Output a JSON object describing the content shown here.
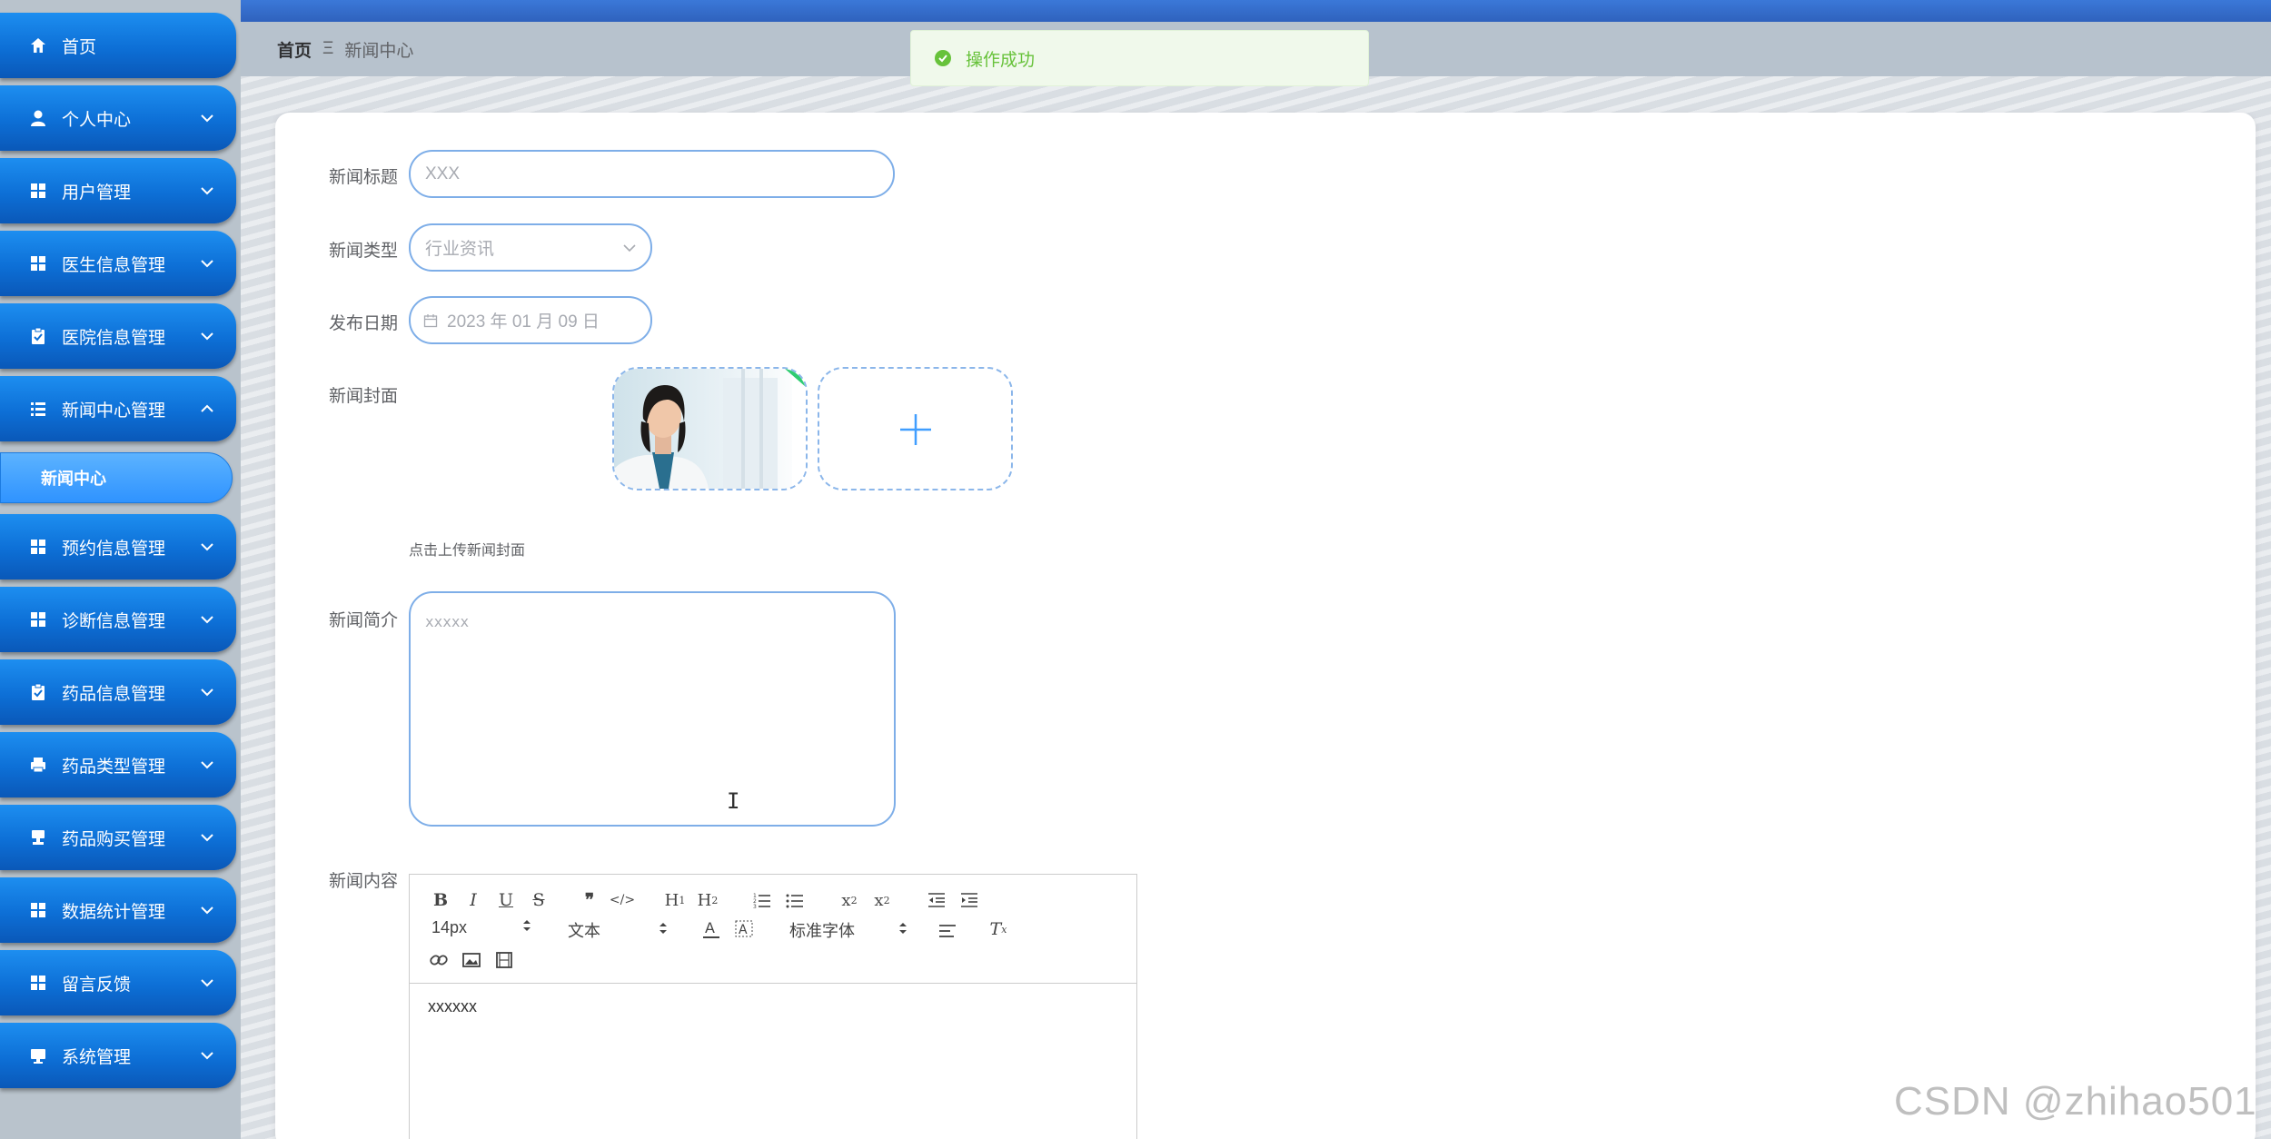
{
  "sidebar": {
    "items": [
      {
        "label": "首页",
        "icon": "home-icon",
        "arrow": ""
      },
      {
        "label": "个人中心",
        "icon": "user-icon",
        "arrow": "down"
      },
      {
        "label": "用户管理",
        "icon": "grid-icon",
        "arrow": "down"
      },
      {
        "label": "医生信息管理",
        "icon": "grid-icon",
        "arrow": "down"
      },
      {
        "label": "医院信息管理",
        "icon": "clipboard-icon",
        "arrow": "down"
      },
      {
        "label": "新闻中心管理",
        "icon": "list-icon",
        "arrow": "up"
      },
      {
        "label": "预约信息管理",
        "icon": "grid-icon",
        "arrow": "down"
      },
      {
        "label": "诊断信息管理",
        "icon": "grid-icon",
        "arrow": "down"
      },
      {
        "label": "药品信息管理",
        "icon": "clipboard-icon",
        "arrow": "down"
      },
      {
        "label": "药品类型管理",
        "icon": "printer-icon",
        "arrow": "down"
      },
      {
        "label": "药品购买管理",
        "icon": "stamp-icon",
        "arrow": "down"
      },
      {
        "label": "数据统计管理",
        "icon": "grid-icon",
        "arrow": "down"
      },
      {
        "label": "留言反馈",
        "icon": "grid-icon",
        "arrow": "down"
      },
      {
        "label": "系统管理",
        "icon": "monitor-icon",
        "arrow": "down"
      }
    ],
    "submenu_active": "新闻中心"
  },
  "breadcrumb": {
    "home": "首页",
    "separator": "Ξ",
    "current": "新闻中心"
  },
  "toast": {
    "message": "操作成功",
    "type": "success",
    "color": "#67c23a"
  },
  "form": {
    "title_label": "新闻标题",
    "title_placeholder": "XXX",
    "type_label": "新闻类型",
    "type_placeholder": "行业资讯",
    "date_label": "发布日期",
    "date_placeholder": "2023 年 01 月 09 日",
    "cover_label": "新闻封面",
    "cover_hint": "点击上传新闻封面",
    "summary_label": "新闻简介",
    "summary_placeholder": "xxxxx",
    "content_label": "新闻内容"
  },
  "editor": {
    "font_size": "14px",
    "header_select": "文本",
    "font_family": "标准字体",
    "content": "xxxxxx"
  },
  "colors": {
    "accent": "#0d6fd6",
    "border": "#7eaee8",
    "success": "#67c23a"
  },
  "watermark": "CSDN @zhihao501"
}
